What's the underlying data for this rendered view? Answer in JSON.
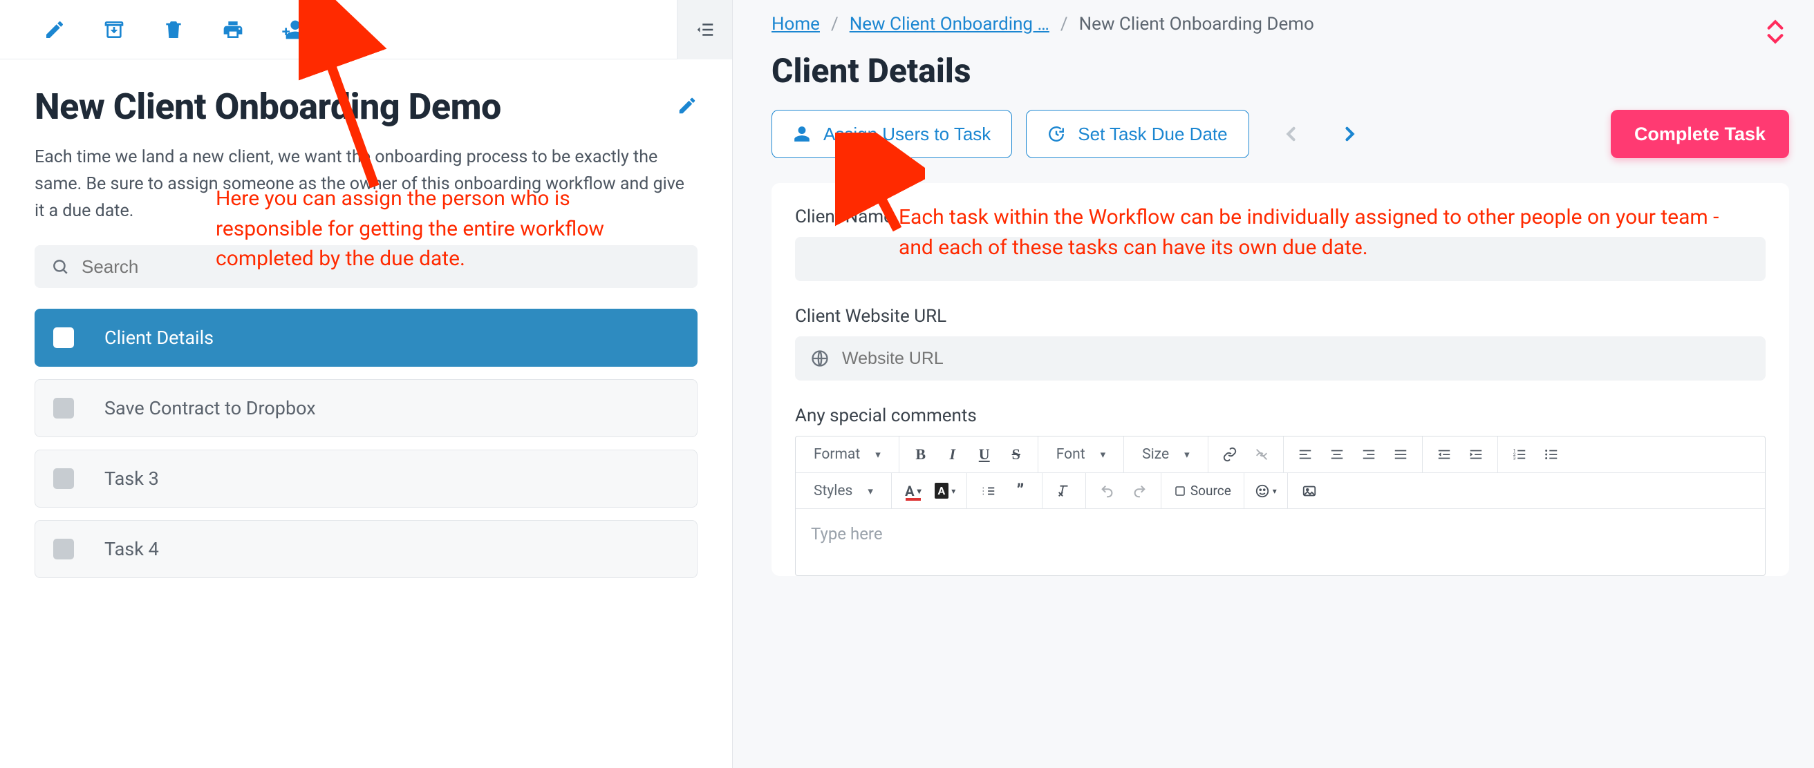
{
  "left": {
    "title": "New Client Onboarding Demo",
    "description": "Each time we land a new client, we want the onboarding process to be exactly the same. Be sure to assign someone as the owner of this onboarding workflow and give it a due date.",
    "search_placeholder": "Search",
    "tasks": [
      {
        "label": "Client Details",
        "active": true
      },
      {
        "label": "Save Contract to Dropbox",
        "active": false
      },
      {
        "label": "Task 3",
        "active": false
      },
      {
        "label": "Task 4",
        "active": false
      }
    ],
    "toolbar_icons": [
      "edit",
      "archive",
      "trash",
      "print",
      "assign-user",
      "history"
    ]
  },
  "right": {
    "breadcrumbs": {
      "home": "Home",
      "template": "New Client Onboarding …",
      "current": "New Client Onboarding Demo"
    },
    "section_title": "Client Details",
    "assign_btn": "Assign Users to Task",
    "due_btn": "Set Task Due Date",
    "complete_btn": "Complete Task",
    "fields": {
      "client_name_label": "Client Name",
      "website_label": "Client Website URL",
      "website_placeholder": "Website URL",
      "comments_label": "Any special comments"
    },
    "rte": {
      "format": "Format",
      "font": "Font",
      "size": "Size",
      "styles": "Styles",
      "source": "Source",
      "placeholder": "Type here"
    }
  },
  "annotations": {
    "left_note": "Here you can assign the person who is responsible for getting the entire workflow completed by the due date.",
    "right_note": "Each task within the Workflow can be individually assigned to other people on your team - and each of these tasks can have its own due date."
  },
  "colors": {
    "primary": "#1b86d1",
    "accent": "#ff3a72",
    "annotation": "#ff2a00"
  }
}
